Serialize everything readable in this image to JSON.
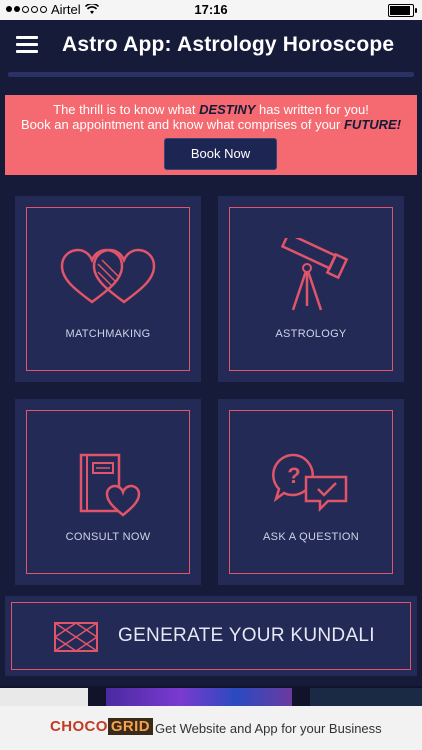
{
  "status_bar": {
    "carrier": "Airtel",
    "time": "17:16"
  },
  "header": {
    "title": "Astro App: Astrology Horoscope"
  },
  "banner": {
    "line1_a": "The thrill is to know what ",
    "line1_b": "DESTINY",
    "line1_c": " has written for you!",
    "line2_a": "Book an appointment and know what comprises of your ",
    "line2_b": "FUTURE!",
    "button_label": "Book Now"
  },
  "tiles": [
    {
      "label": "MATCHMAKING",
      "icon": "hearts-icon"
    },
    {
      "label": "ASTROLOGY",
      "icon": "telescope-icon"
    },
    {
      "label": "CONSULT NOW",
      "icon": "book-heart-icon"
    },
    {
      "label": "ASK A QUESTION",
      "icon": "question-chat-icon"
    }
  ],
  "kundali": {
    "label": "GENERATE YOUR KUNDALI",
    "icon": "kundali-grid-icon"
  },
  "ad": {
    "logo_a": "CHOCO",
    "logo_b": "GRID",
    "text": "Get Website and App for your Business"
  },
  "colors": {
    "background": "#161b3a",
    "accent": "#e0556a",
    "banner": "#f56a70",
    "tile": "#232a55"
  }
}
